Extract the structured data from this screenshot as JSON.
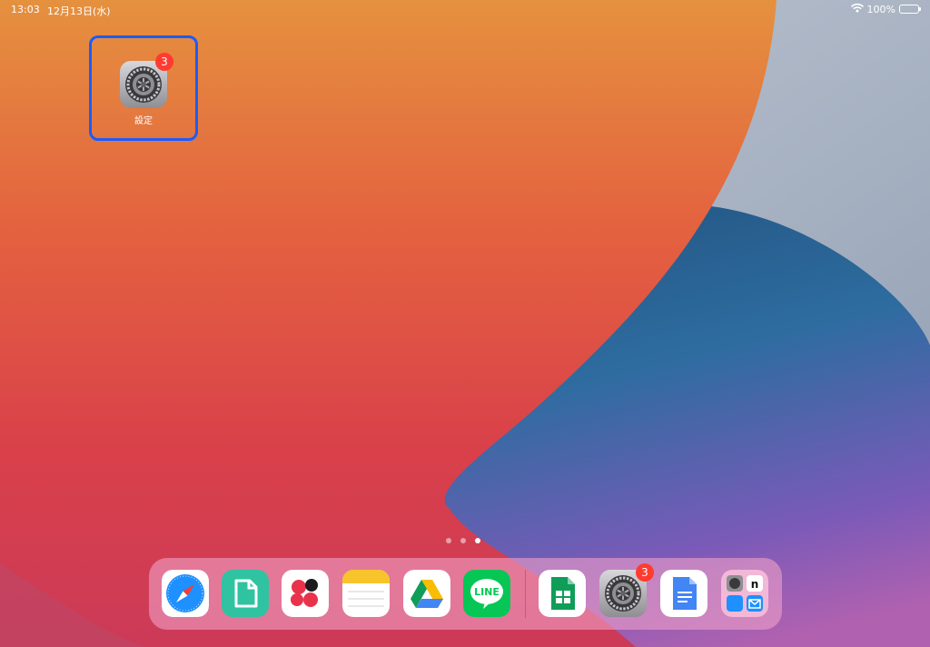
{
  "status_bar": {
    "time": "13:03",
    "date": "12月13日(水)",
    "battery_percent": "100%",
    "battery_level": 1.0,
    "icons": [
      "wifi-icon",
      "battery-charging-icon"
    ]
  },
  "home": {
    "app": {
      "label": "設定",
      "badge": "3",
      "icon": "settings-gear-icon",
      "highlight_color": "#1a5cff"
    },
    "page_dots": {
      "count": 3,
      "active_index": 2
    }
  },
  "dock": {
    "apps": [
      {
        "icon": "safari-icon"
      },
      {
        "icon": "files-green-document-icon"
      },
      {
        "icon": "flower-petals-app-icon"
      },
      {
        "icon": "notes-icon"
      },
      {
        "icon": "google-drive-icon"
      },
      {
        "icon": "line-icon",
        "text": "LINE"
      },
      {
        "icon": "google-sheets-icon"
      },
      {
        "icon": "settings-gear-icon",
        "badge": "3"
      },
      {
        "icon": "google-docs-icon"
      },
      {
        "icon": "app-folder-icon"
      }
    ]
  },
  "colors": {
    "badge": "#ff3b30",
    "wall_orange": "#e88a3f",
    "wall_red": "#dc4647",
    "wall_blue": "#2e6ca0",
    "wall_purple": "#8a4fb0"
  }
}
